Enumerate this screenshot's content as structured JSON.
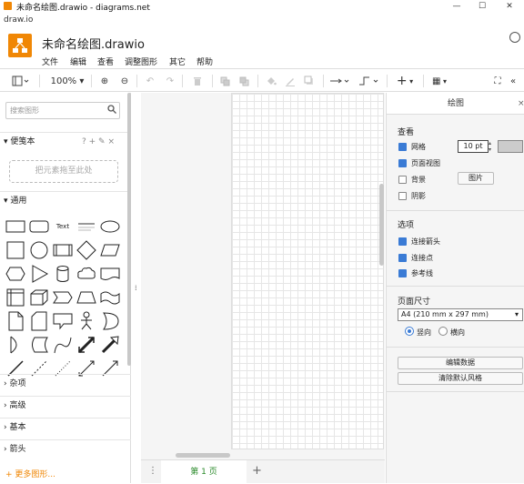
{
  "window": {
    "title": "未命名绘图.drawio - diagrams.net",
    "min": "—",
    "max": "☐",
    "close": "✕"
  },
  "url": "draw.io",
  "header": {
    "doc_title": "未命名绘图.drawio",
    "menus": [
      "文件",
      "编辑",
      "查看",
      "调整图形",
      "其它",
      "帮助"
    ]
  },
  "toolbar": {
    "zoom": "100%",
    "zoom_in": "⊕",
    "zoom_out": "⊖",
    "undo": "↶",
    "redo": "↷",
    "delete": "🗑",
    "insert": "+",
    "table": "▦",
    "fullscreen": "⛶",
    "collapse": "«"
  },
  "left": {
    "search_placeholder": "搜索图形",
    "scratchpad_title": "便笺本",
    "scratchpad_icons": "? + ✎ ×",
    "dropzone": "把元素拖至此处",
    "sections": [
      "通用",
      "杂项",
      "高级",
      "基本",
      "箭头"
    ],
    "text_shape": "Text",
    "more_shapes": "+ 更多图形..."
  },
  "bottom": {
    "page_tab": "第 1 页",
    "add_page": "+",
    "menu": "⋮"
  },
  "right": {
    "title": "绘图",
    "close": "×",
    "view_title": "查看",
    "grid_label": "网格",
    "grid_size": "10 pt",
    "page_view_label": "页面视图",
    "background_label": "背景",
    "background_button": "图片",
    "shadow_label": "阴影",
    "options_title": "选项",
    "connection_arrows": "连接箭头",
    "connection_points": "连接点",
    "guides": "参考线",
    "paper_title": "页面尺寸",
    "paper_size": "A4 (210 mm x 297 mm)",
    "portrait": "竖向",
    "landscape": "横向",
    "edit_data": "编辑数据",
    "clear_style": "清除默认风格"
  },
  "colors": {
    "accent": "#f08705",
    "checkbox": "#3a7bd5",
    "page_tab_text": "#2a8a2a"
  }
}
